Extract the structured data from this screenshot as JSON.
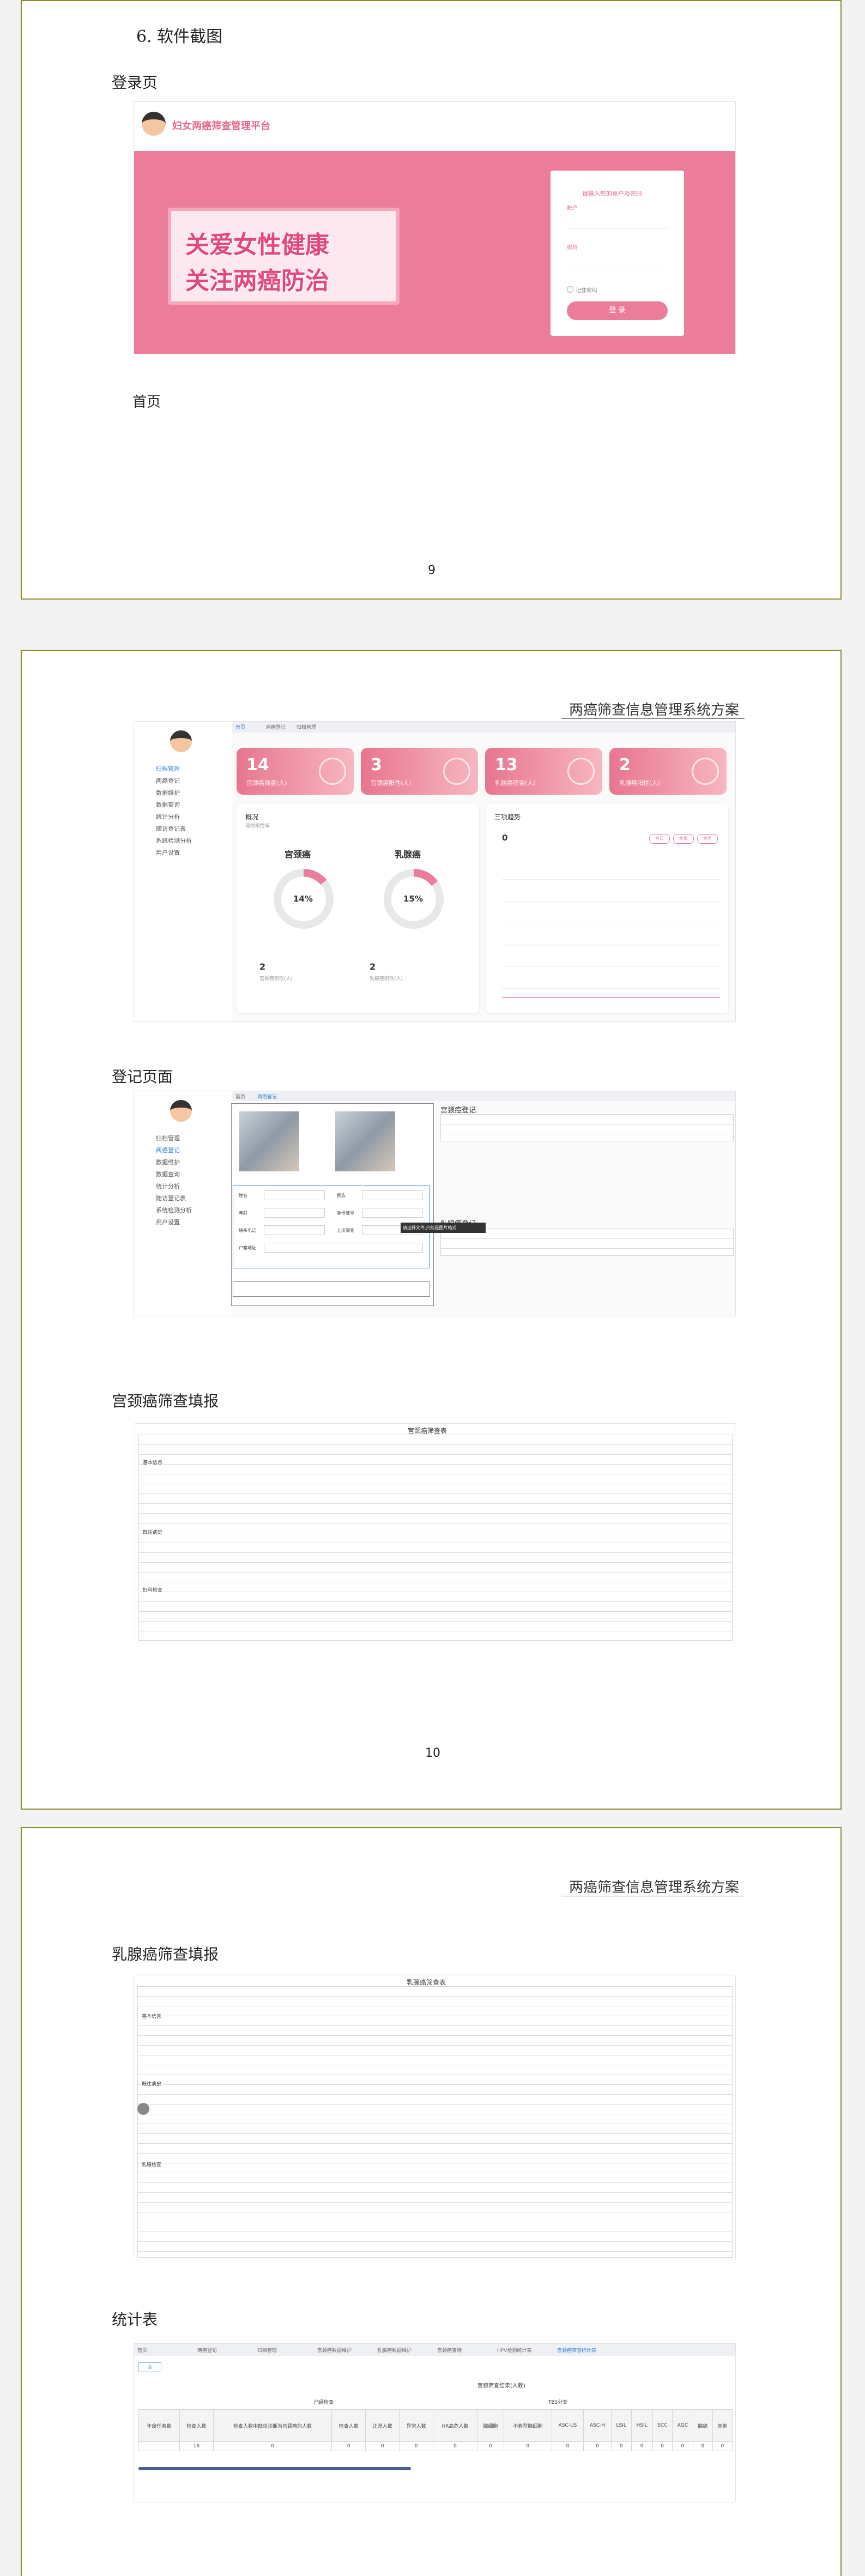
{
  "section_heading": "6.  软件截图",
  "doc_header": "两癌筛查信息管理系统方案",
  "captions": {
    "login": "登录页",
    "home": "首页",
    "register": "登记页面",
    "cervical": "宫颈癌筛查填报",
    "breast": "乳腺癌筛查填报",
    "stats": "统计表"
  },
  "page_numbers": [
    "9",
    "10"
  ],
  "login": {
    "brand": "妇女两癌筛查管理平台",
    "banner_line1": "关爱女性健康",
    "banner_line2": "关注两癌防治",
    "form_title": "请输入您的账户及密码",
    "account_label": "账户",
    "password_label": "密码",
    "remember_label": "记住密码",
    "login_button": "登 录"
  },
  "home": {
    "tabs": [
      "首页",
      "两癌登记",
      "归档管理"
    ],
    "sidebar": [
      "归档管理",
      "两癌登记",
      "数据维护",
      "数据查询",
      "统计分析",
      "随访登记表",
      "系统检测分析",
      "用户设置"
    ],
    "stats": [
      {
        "value": "14",
        "label": "宫颈癌筛查(人)"
      },
      {
        "value": "3",
        "label": "宫颈癌阳性(人)"
      },
      {
        "value": "13",
        "label": "乳腺癌筛查(人)"
      },
      {
        "value": "2",
        "label": "乳腺癌阳性(人)"
      }
    ],
    "overview_title": "概况",
    "overview_sub": "两癌阳性率",
    "cervical_title": "宫颈癌",
    "breast_title": "乳腺癌",
    "cervical_pct": "14%",
    "breast_pct": "15%",
    "cervical_pct_value": 14,
    "breast_pct_value": 15,
    "cervical_count": "2",
    "cervical_count_label": "宫颈癌阳性(人)",
    "breast_count": "2",
    "breast_count_label": "乳腺癌阳性(人)",
    "trend_title": "三项趋势",
    "trend_value": "0",
    "trend_buttons": [
      "今日",
      "本周",
      "本月"
    ]
  },
  "register": {
    "tabs": [
      "首页",
      "两癌登记"
    ],
    "cervical_list_title": "宫颈癌登记",
    "breast_list_title": "乳腺癌登记",
    "tooltip": "请选择文件,只能是图片格式",
    "form_labels": [
      "姓名",
      "民族",
      "年龄",
      "身份证号",
      "联系电话",
      "上次筛查",
      "户籍地址"
    ]
  },
  "cervical_form": {
    "title": "宫颈癌筛查表",
    "groups": [
      "基本信息",
      "既往病史",
      "妇科检查"
    ]
  },
  "breast_form": {
    "title": "乳腺癌筛查表",
    "groups": [
      "基本信息",
      "既往病史",
      "乳腺检查"
    ]
  },
  "stats_table": {
    "tabs": [
      "首页",
      "两癌登记",
      "归档管理",
      "宫颈癌数据维护",
      "乳腺癌数据维护",
      "宫颈癌查询",
      "HPV检测统计表",
      "宫颈癌筛查统计表"
    ],
    "col_group": "宫颈筛查结果(人数)",
    "col_sub": "TBS分类",
    "sub_header": "已经检查",
    "columns": [
      "年度任务数",
      "检查人数",
      "检查人数中既往诊断为宫颈癌的人数",
      "检查人数",
      "正常人数",
      "异常人数",
      "HR高危人数",
      "腺细胞",
      "不典型腺细胞",
      "ASC-US",
      "ASC-H",
      "LSIL",
      "HSIL",
      "SCC",
      "AGC",
      "腺癌",
      "其他"
    ],
    "row": [
      "",
      "16",
      "0",
      "0",
      "0",
      "0",
      "0",
      "0",
      "0",
      "0",
      "0",
      "0",
      "0",
      "0",
      "0",
      "0",
      "0"
    ]
  }
}
